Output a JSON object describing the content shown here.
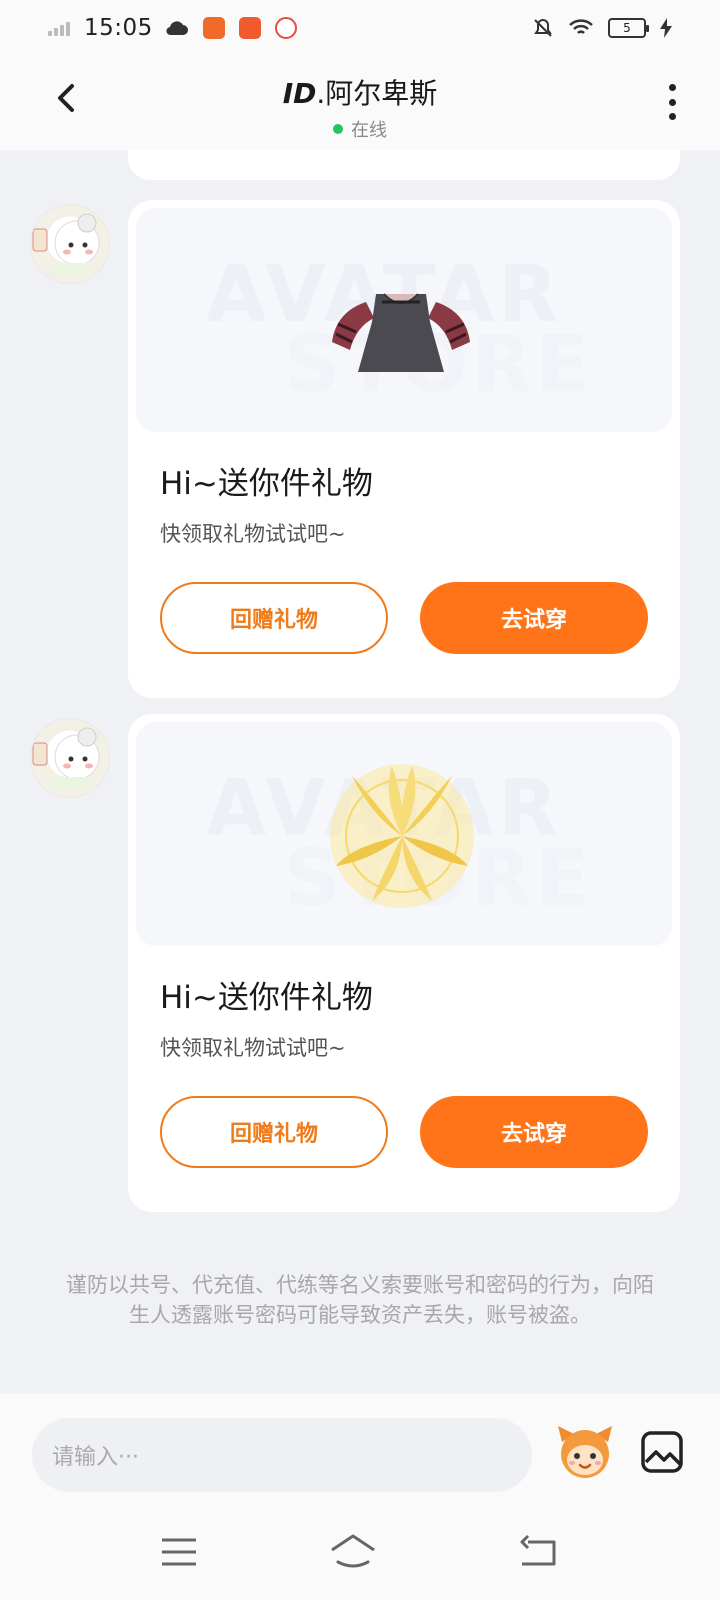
{
  "status_bar": {
    "time": "15:05",
    "battery": "5"
  },
  "header": {
    "title_id": "ID",
    "title_name": ".阿尔卑斯",
    "status": "在线",
    "status_color": "#22c55e"
  },
  "messages": [
    {
      "watermark_top": "AVATAR",
      "watermark_bottom": "STORE",
      "item_icon": "dress-icon",
      "title": "Hi~送你件礼物",
      "subtitle": "快领取礼物试试吧~",
      "return_label": "回赠礼物",
      "try_label": "去试穿"
    },
    {
      "watermark_top": "AVATAR",
      "watermark_bottom": "STORE",
      "item_icon": "golden-wings-icon",
      "title": "Hi~送你件礼物",
      "subtitle": "快领取礼物试试吧~",
      "return_label": "回赠礼物",
      "try_label": "去试穿"
    }
  ],
  "warning": "谨防以共号、代充值、代练等名义索要账号和密码的行为，向陌生人透露账号密码可能导致资产丢失，账号被盗。",
  "input": {
    "placeholder": "请输入···"
  },
  "colors": {
    "accent": "#ff7418",
    "accent_border": "#f07b1a"
  }
}
